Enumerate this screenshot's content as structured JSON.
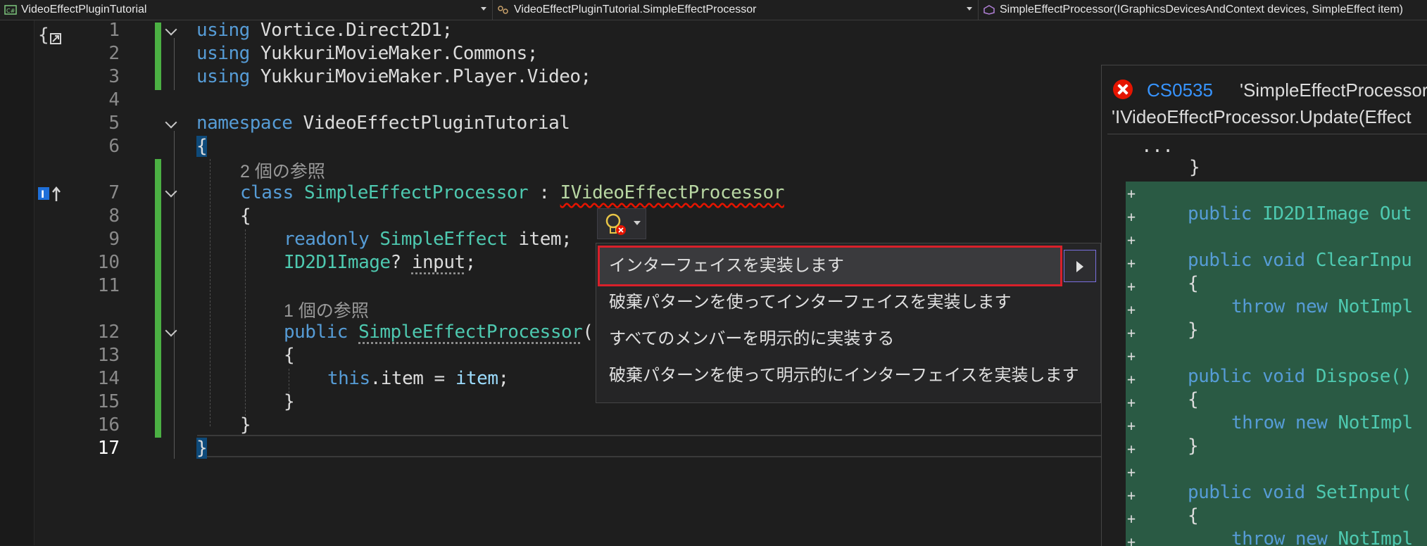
{
  "navbar": {
    "project": "VideoEffectPluginTutorial",
    "type": "VideoEffectPluginTutorial.SimpleEffectProcessor",
    "member": "SimpleEffectProcessor(IGraphicsDevicesAndContext devices, SimpleEffect item)"
  },
  "editor": {
    "line_numbers": [
      "1",
      "2",
      "3",
      "4",
      "5",
      "6",
      "7",
      "8",
      "9",
      "10",
      "11",
      "12",
      "13",
      "14",
      "15",
      "16",
      "17"
    ],
    "current_line": "17",
    "references": {
      "class_refs": "2 個の参照",
      "ctor_refs": "1 個の参照"
    },
    "code": {
      "l1_kw": "using",
      "l1_rest": " Vortice.Direct2D1;",
      "l2_kw": "using",
      "l2_rest": " YukkuriMovieMaker.Commons;",
      "l3_kw": "using",
      "l3_rest": " YukkuriMovieMaker.Player.Video;",
      "l5_kw": "namespace",
      "l5_rest": " VideoEffectPluginTutorial",
      "l6": "{",
      "l7_kw": "class",
      "l7_type": "SimpleEffectProcessor",
      "l7_colon": " : ",
      "l7_iface": "IVideoEffectProcessor",
      "l8": "{",
      "l9_kw": "readonly",
      "l9_type": "SimpleEffect",
      "l9_rest": " item;",
      "l10_type": "ID2D1Image",
      "l10_q": "? ",
      "l10_name": "input",
      "l10_end": ";",
      "l12_kw": "public",
      "l12_type": "SimpleEffectProcessor",
      "l12_rest": "(",
      "l13": "{",
      "l14_kw": "this",
      "l14_rest": ".item = ",
      "l14_var": "item",
      "l14_end": ";",
      "l15": "}",
      "l16": "}",
      "l17": "}"
    }
  },
  "quick_actions": {
    "items": [
      "インターフェイスを実装します",
      "破棄パターンを使ってインターフェイスを実装します",
      "すべてのメンバーを明示的に実装する",
      "破棄パターンを使って明示的にインターフェイスを実装します"
    ]
  },
  "preview": {
    "error_code": "CS0535",
    "error_message": "'SimpleEffectProcessor' i",
    "error_message_2": "'IVideoEffectProcessor.Update(Effect",
    "ellipsis": "...",
    "close_brace": "}",
    "plus": "+",
    "lines": {
      "p1_kw": "public",
      "p1_type": " ID2D1Image",
      "p1_rest": " Out",
      "p2_kw": "public",
      "p2_kw2": " void",
      "p2_rest": " ClearInpu",
      "open": "{",
      "throw_kw": "throw",
      "new_kw": " new",
      "notimpl": " NotImpl",
      "close": "}",
      "p3_kw": "public",
      "p3_kw2": " void",
      "p3_rest": " Dispose()",
      "p4_kw": "public",
      "p4_kw2": " void",
      "p4_rest": " SetInput("
    }
  },
  "colors": {
    "keyword": "#569cd6",
    "type": "#4ec9b0",
    "error": "#e51400",
    "change_bar": "#4bb043",
    "selection_border": "#d9202a"
  }
}
